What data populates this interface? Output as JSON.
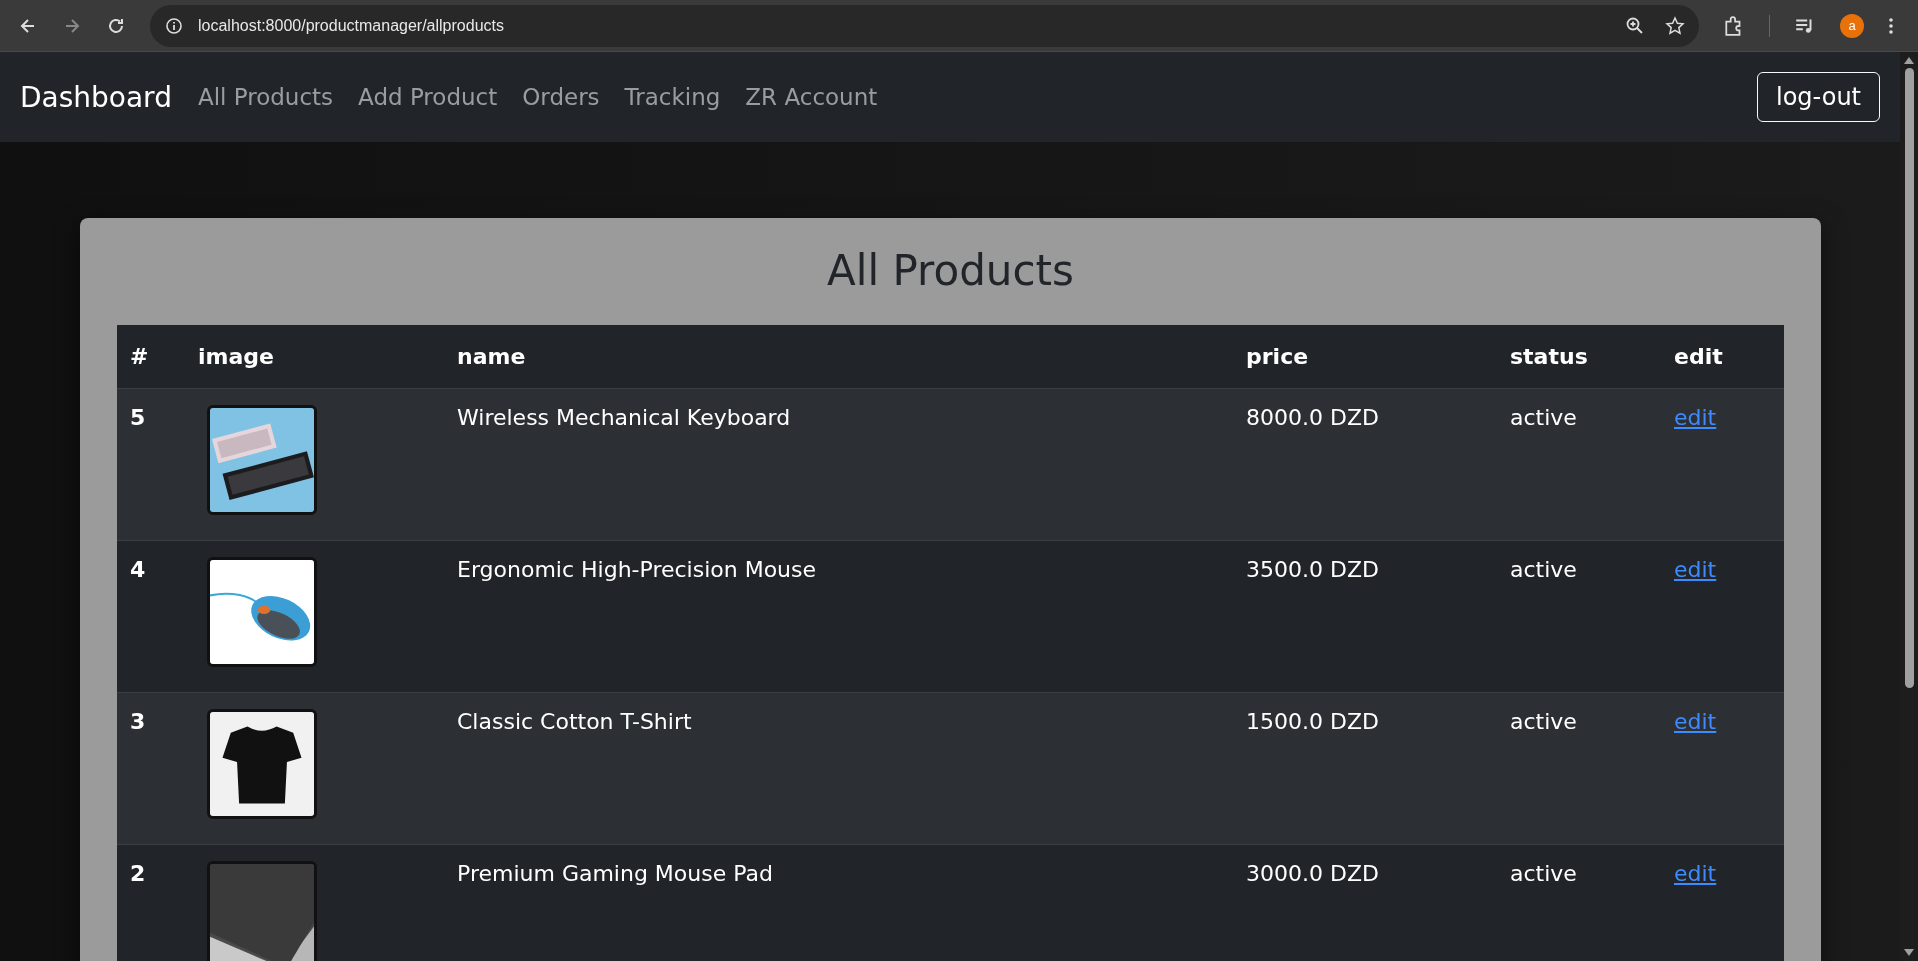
{
  "browser": {
    "url": "localhost:8000/productmanager/allproducts",
    "profile_initial": "a"
  },
  "navbar": {
    "brand": "Dashboard",
    "links": [
      "All Products",
      "Add Product",
      "Orders",
      "Tracking",
      "ZR Account"
    ],
    "logout": "log-out"
  },
  "page": {
    "title": "All Products"
  },
  "table": {
    "columns": [
      "#",
      "image",
      "name",
      "price",
      "status",
      "edit"
    ],
    "rows": [
      {
        "id": "5",
        "name": "Wireless Mechanical Keyboard",
        "price": "8000.0 DZD",
        "status": "active",
        "edit": "edit"
      },
      {
        "id": "4",
        "name": "Ergonomic High-Precision Mouse",
        "price": "3500.0 DZD",
        "status": "active",
        "edit": "edit"
      },
      {
        "id": "3",
        "name": "Classic Cotton T-Shirt",
        "price": "1500.0 DZD",
        "status": "active",
        "edit": "edit"
      },
      {
        "id": "2",
        "name": "Premium Gaming Mouse Pad",
        "price": "3000.0 DZD",
        "status": "active",
        "edit": "edit"
      }
    ]
  }
}
